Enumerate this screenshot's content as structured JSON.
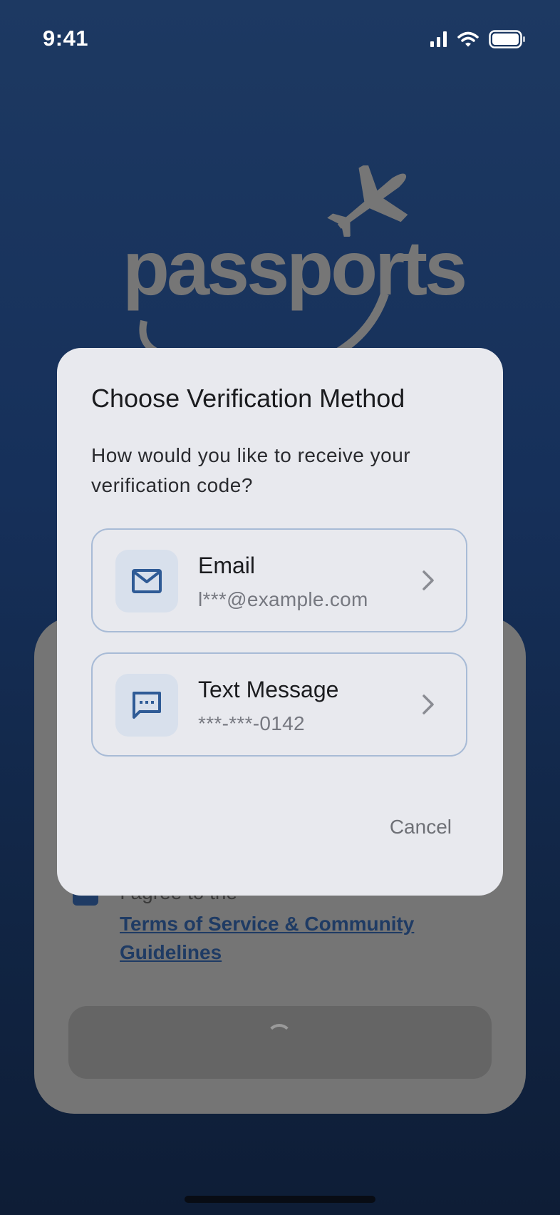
{
  "status_bar": {
    "time": "9:41",
    "icons": [
      "cellular-signal-icon",
      "wifi-icon",
      "battery-icon"
    ]
  },
  "logo": {
    "text": "passports",
    "icon": "airplane-icon"
  },
  "background_form": {
    "checkbox_checked": true,
    "agree_text": "I agree to the",
    "terms_link": "Terms of Service & Community Guidelines",
    "submit_state": "loading"
  },
  "dialog": {
    "title": "Choose Verification Method",
    "body": "How would you like to receive your verification code?",
    "options": [
      {
        "title": "Email",
        "subtitle": "l***@example.com",
        "icon": "envelope-icon"
      },
      {
        "title": "Text Message",
        "subtitle": "***-***-0142",
        "icon": "message-icon"
      }
    ],
    "cancel_label": "Cancel"
  },
  "colors": {
    "background_top": "#1d3962",
    "background_bottom": "#0e1d36",
    "dialog_bg": "#e8e9ee",
    "accent": "#2f5b96",
    "option_border": "#a8bbd6"
  }
}
